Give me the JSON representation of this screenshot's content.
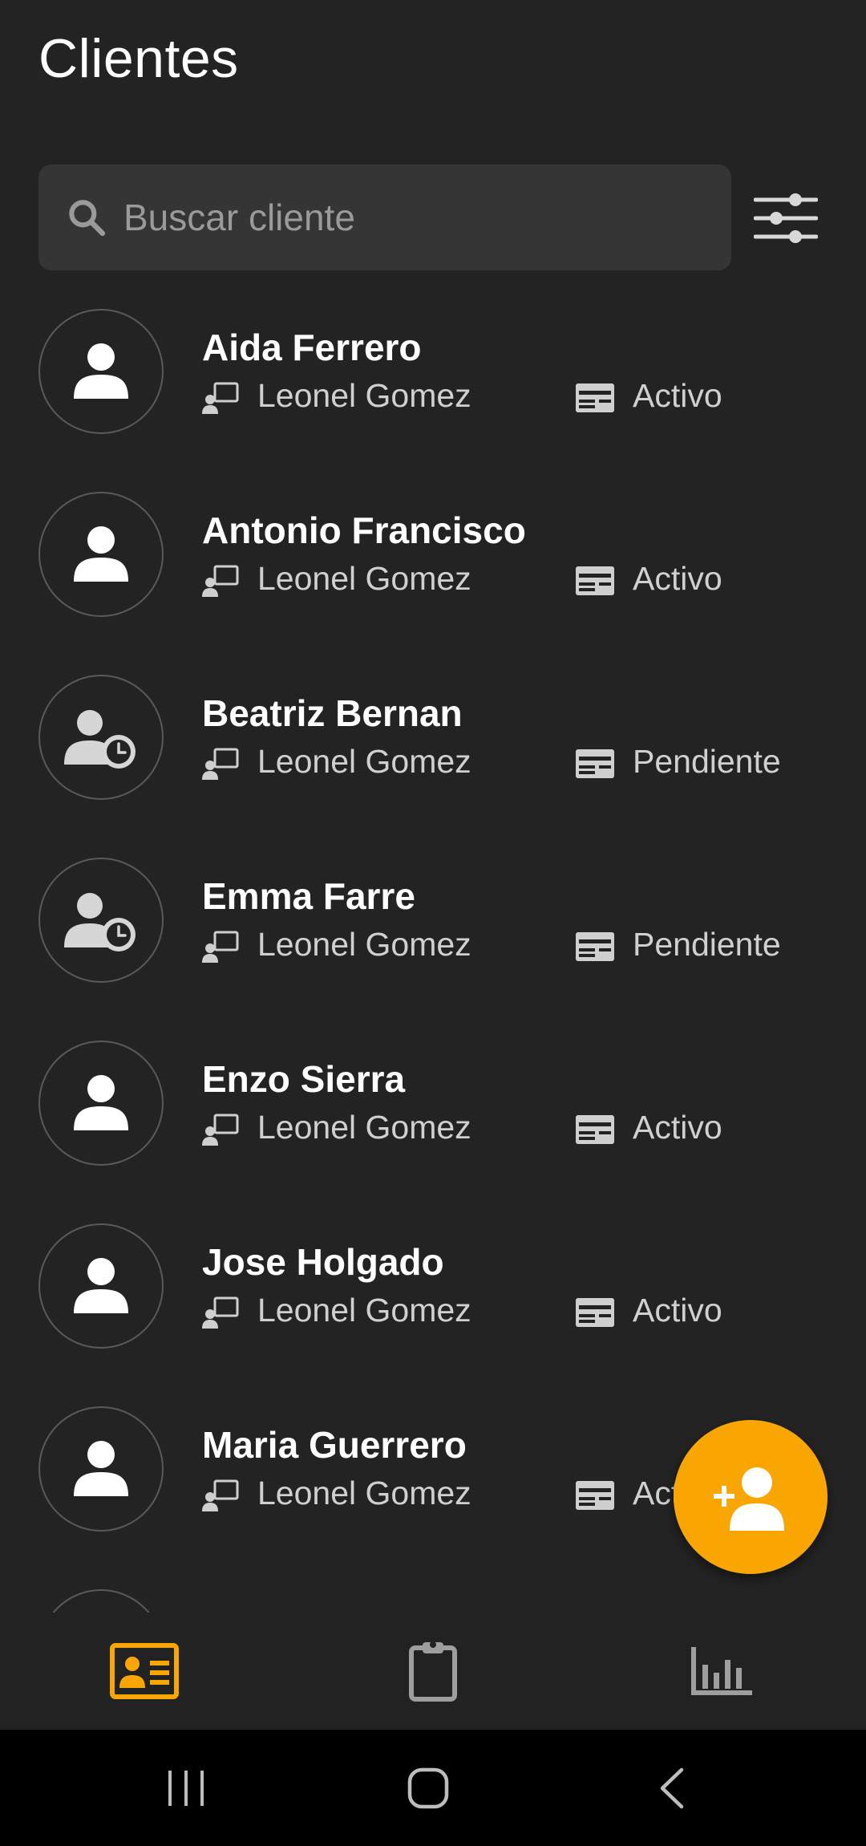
{
  "header": {
    "title": "Clientes"
  },
  "search": {
    "placeholder": "Buscar cliente"
  },
  "clients": [
    {
      "name": "Aida Ferrero",
      "agent": "Leonel Gomez",
      "status": "Activo",
      "avatar_icon": "person-icon"
    },
    {
      "name": "Antonio Francisco",
      "agent": "Leonel Gomez",
      "status": "Activo",
      "avatar_icon": "person-icon"
    },
    {
      "name": "Beatriz Bernan",
      "agent": "Leonel Gomez",
      "status": "Pendiente",
      "avatar_icon": "person-clock-icon"
    },
    {
      "name": "Emma Farre",
      "agent": "Leonel Gomez",
      "status": "Pendiente",
      "avatar_icon": "person-clock-icon"
    },
    {
      "name": "Enzo Sierra",
      "agent": "Leonel Gomez",
      "status": "Activo",
      "avatar_icon": "person-icon"
    },
    {
      "name": "Jose Holgado",
      "agent": "Leonel Gomez",
      "status": "Activo",
      "avatar_icon": "person-icon"
    },
    {
      "name": "Maria Guerrero",
      "agent": "Leonel Gomez",
      "status": "Activo",
      "avatar_icon": "person-icon"
    }
  ],
  "fab": {
    "icon": "add-person-icon"
  },
  "bottom_nav": {
    "items": [
      {
        "icon": "contact-card-icon",
        "active": true
      },
      {
        "icon": "clipboard-icon",
        "active": false
      },
      {
        "icon": "bar-chart-icon",
        "active": false
      }
    ]
  },
  "system_nav": {
    "items": [
      "recents-icon",
      "home-icon",
      "back-icon"
    ]
  },
  "colors": {
    "background": "#232323",
    "search_background": "#353535",
    "accent": "#f9a602",
    "text_primary": "#ffffff",
    "text_secondary": "#d0d0d0",
    "inactive_icon": "#9e9e9e"
  }
}
